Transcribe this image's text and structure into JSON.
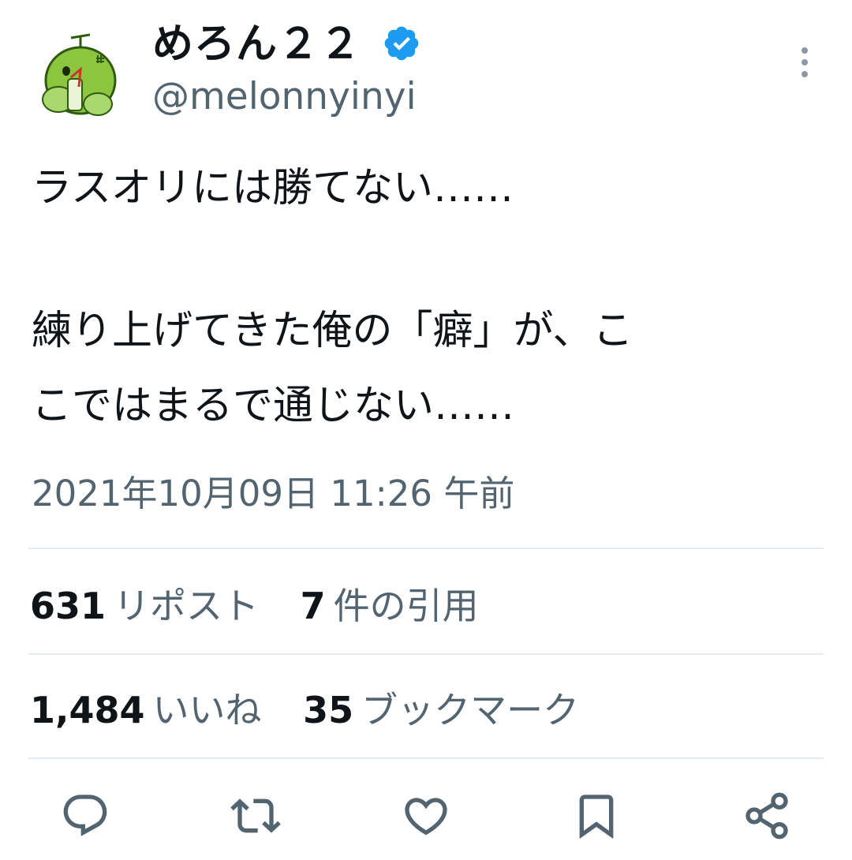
{
  "author": {
    "display_name": "めろん２２",
    "handle": "@melonnyinyi",
    "verified": true,
    "verified_color": "#1d9bf0",
    "avatar_icon": "melon-character-avatar"
  },
  "tweet": {
    "lines": [
      "ラスオリには勝てない……",
      "練り上げてきた俺の「癖」が、こ",
      "こではまるで通じない……"
    ],
    "timestamp": "2021年10月09日 11:26 午前"
  },
  "stats": {
    "reposts": {
      "count": "631",
      "label": "リポスト"
    },
    "quotes": {
      "count": "7",
      "label": "件の引用"
    },
    "likes": {
      "count": "1,484",
      "label": "いいね"
    },
    "bookmarks": {
      "count": "35",
      "label": "ブックマーク"
    }
  },
  "actions": [
    {
      "icon": "reply-icon"
    },
    {
      "icon": "repost-icon"
    },
    {
      "icon": "like-icon"
    },
    {
      "icon": "bookmark-icon"
    },
    {
      "icon": "share-icon"
    }
  ],
  "colors": {
    "text": "#0f1419",
    "secondary": "#536471",
    "divider": "#e6ecf0"
  }
}
